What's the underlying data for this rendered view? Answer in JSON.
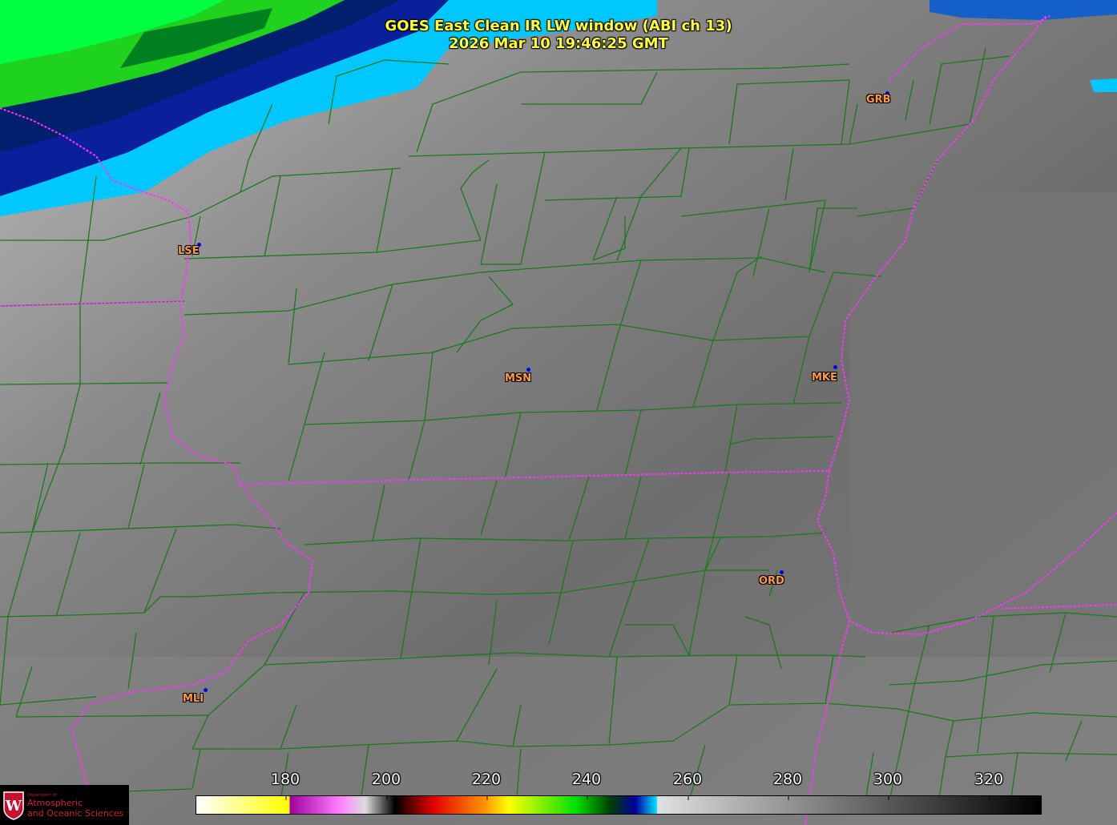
{
  "title": {
    "line1": "GOES East Clean IR LW window (ABI ch 13)",
    "line2": "2026 Mar 10  19:46:25 GMT"
  },
  "stations": [
    {
      "code": "GRB"
    },
    {
      "code": "LSE"
    },
    {
      "code": "MSN"
    },
    {
      "code": "MKE"
    },
    {
      "code": "ORD"
    },
    {
      "code": "MLI"
    }
  ],
  "colorbar": {
    "ticks": [
      "180",
      "200",
      "220",
      "240",
      "260",
      "280",
      "300",
      "320"
    ],
    "colors": {
      "cold_start": "#ffffff",
      "yellow": "#ffff00",
      "magenta": "#c000c0",
      "red": "#e00000",
      "orange": "#ff9000",
      "green": "#00e000",
      "blue": "#0000a0",
      "cyan": "#00e0ff",
      "warm_end": "#000000"
    }
  },
  "logo": {
    "line1": "Department of",
    "line2": "Atmospheric",
    "line3": "and Oceanic Sciences",
    "seal_letter": "W"
  },
  "colors": {
    "county_lines": "#1a7a1a",
    "state_lines": "#ff33ff",
    "station_label": "#ff9a3c",
    "title": "#ffff33"
  }
}
